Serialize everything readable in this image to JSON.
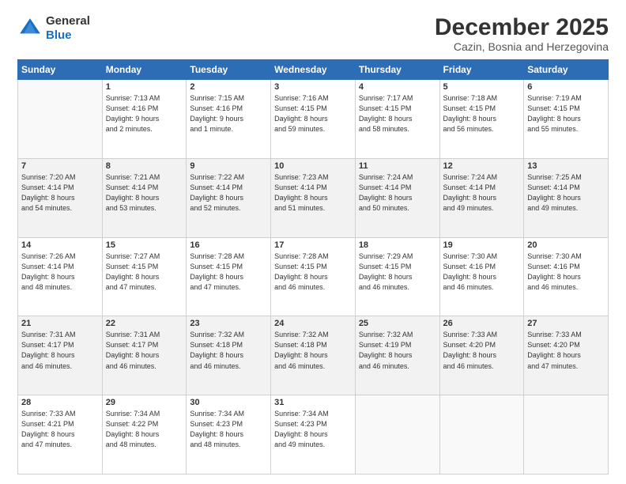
{
  "header": {
    "logo_line1": "General",
    "logo_line2": "Blue",
    "title": "December 2025",
    "subtitle": "Cazin, Bosnia and Herzegovina"
  },
  "days_of_week": [
    "Sunday",
    "Monday",
    "Tuesday",
    "Wednesday",
    "Thursday",
    "Friday",
    "Saturday"
  ],
  "weeks": [
    [
      {
        "day": "",
        "info": ""
      },
      {
        "day": "1",
        "info": "Sunrise: 7:13 AM\nSunset: 4:16 PM\nDaylight: 9 hours\nand 2 minutes."
      },
      {
        "day": "2",
        "info": "Sunrise: 7:15 AM\nSunset: 4:16 PM\nDaylight: 9 hours\nand 1 minute."
      },
      {
        "day": "3",
        "info": "Sunrise: 7:16 AM\nSunset: 4:15 PM\nDaylight: 8 hours\nand 59 minutes."
      },
      {
        "day": "4",
        "info": "Sunrise: 7:17 AM\nSunset: 4:15 PM\nDaylight: 8 hours\nand 58 minutes."
      },
      {
        "day": "5",
        "info": "Sunrise: 7:18 AM\nSunset: 4:15 PM\nDaylight: 8 hours\nand 56 minutes."
      },
      {
        "day": "6",
        "info": "Sunrise: 7:19 AM\nSunset: 4:15 PM\nDaylight: 8 hours\nand 55 minutes."
      }
    ],
    [
      {
        "day": "7",
        "info": "Sunrise: 7:20 AM\nSunset: 4:14 PM\nDaylight: 8 hours\nand 54 minutes."
      },
      {
        "day": "8",
        "info": "Sunrise: 7:21 AM\nSunset: 4:14 PM\nDaylight: 8 hours\nand 53 minutes."
      },
      {
        "day": "9",
        "info": "Sunrise: 7:22 AM\nSunset: 4:14 PM\nDaylight: 8 hours\nand 52 minutes."
      },
      {
        "day": "10",
        "info": "Sunrise: 7:23 AM\nSunset: 4:14 PM\nDaylight: 8 hours\nand 51 minutes."
      },
      {
        "day": "11",
        "info": "Sunrise: 7:24 AM\nSunset: 4:14 PM\nDaylight: 8 hours\nand 50 minutes."
      },
      {
        "day": "12",
        "info": "Sunrise: 7:24 AM\nSunset: 4:14 PM\nDaylight: 8 hours\nand 49 minutes."
      },
      {
        "day": "13",
        "info": "Sunrise: 7:25 AM\nSunset: 4:14 PM\nDaylight: 8 hours\nand 49 minutes."
      }
    ],
    [
      {
        "day": "14",
        "info": "Sunrise: 7:26 AM\nSunset: 4:14 PM\nDaylight: 8 hours\nand 48 minutes."
      },
      {
        "day": "15",
        "info": "Sunrise: 7:27 AM\nSunset: 4:15 PM\nDaylight: 8 hours\nand 47 minutes."
      },
      {
        "day": "16",
        "info": "Sunrise: 7:28 AM\nSunset: 4:15 PM\nDaylight: 8 hours\nand 47 minutes."
      },
      {
        "day": "17",
        "info": "Sunrise: 7:28 AM\nSunset: 4:15 PM\nDaylight: 8 hours\nand 46 minutes."
      },
      {
        "day": "18",
        "info": "Sunrise: 7:29 AM\nSunset: 4:15 PM\nDaylight: 8 hours\nand 46 minutes."
      },
      {
        "day": "19",
        "info": "Sunrise: 7:30 AM\nSunset: 4:16 PM\nDaylight: 8 hours\nand 46 minutes."
      },
      {
        "day": "20",
        "info": "Sunrise: 7:30 AM\nSunset: 4:16 PM\nDaylight: 8 hours\nand 46 minutes."
      }
    ],
    [
      {
        "day": "21",
        "info": "Sunrise: 7:31 AM\nSunset: 4:17 PM\nDaylight: 8 hours\nand 46 minutes."
      },
      {
        "day": "22",
        "info": "Sunrise: 7:31 AM\nSunset: 4:17 PM\nDaylight: 8 hours\nand 46 minutes."
      },
      {
        "day": "23",
        "info": "Sunrise: 7:32 AM\nSunset: 4:18 PM\nDaylight: 8 hours\nand 46 minutes."
      },
      {
        "day": "24",
        "info": "Sunrise: 7:32 AM\nSunset: 4:18 PM\nDaylight: 8 hours\nand 46 minutes."
      },
      {
        "day": "25",
        "info": "Sunrise: 7:32 AM\nSunset: 4:19 PM\nDaylight: 8 hours\nand 46 minutes."
      },
      {
        "day": "26",
        "info": "Sunrise: 7:33 AM\nSunset: 4:20 PM\nDaylight: 8 hours\nand 46 minutes."
      },
      {
        "day": "27",
        "info": "Sunrise: 7:33 AM\nSunset: 4:20 PM\nDaylight: 8 hours\nand 47 minutes."
      }
    ],
    [
      {
        "day": "28",
        "info": "Sunrise: 7:33 AM\nSunset: 4:21 PM\nDaylight: 8 hours\nand 47 minutes."
      },
      {
        "day": "29",
        "info": "Sunrise: 7:34 AM\nSunset: 4:22 PM\nDaylight: 8 hours\nand 48 minutes."
      },
      {
        "day": "30",
        "info": "Sunrise: 7:34 AM\nSunset: 4:23 PM\nDaylight: 8 hours\nand 48 minutes."
      },
      {
        "day": "31",
        "info": "Sunrise: 7:34 AM\nSunset: 4:23 PM\nDaylight: 8 hours\nand 49 minutes."
      },
      {
        "day": "",
        "info": ""
      },
      {
        "day": "",
        "info": ""
      },
      {
        "day": "",
        "info": ""
      }
    ]
  ],
  "row_shades": [
    false,
    true,
    false,
    true,
    false
  ]
}
